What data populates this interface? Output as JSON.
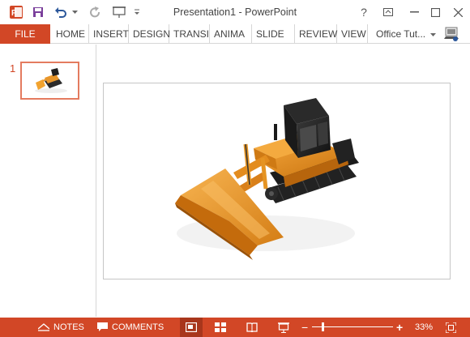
{
  "window": {
    "title": "Presentation1 - PowerPoint",
    "help_label": "?"
  },
  "quick_access": {
    "app_icon": "powerpoint-logo-icon",
    "save_icon": "save-icon",
    "undo_icon": "undo-icon",
    "redo_icon": "redo-icon",
    "present_icon": "present-from-start-icon",
    "customize_icon": "customize-qat-icon"
  },
  "ribbon": {
    "file_label": "FILE",
    "tabs": [
      {
        "label": "HOME"
      },
      {
        "label": "INSERT"
      },
      {
        "label": "DESIGN"
      },
      {
        "label": "TRANSI"
      },
      {
        "label": "ANIMA"
      },
      {
        "label": "SLIDE S"
      },
      {
        "label": "REVIEW"
      },
      {
        "label": "VIEW"
      }
    ],
    "account_name": "Office Tut...",
    "accent_color": "#d24726"
  },
  "thumbnails": {
    "slides": [
      {
        "number": "1",
        "selected": true,
        "content": "bulldozer-image"
      }
    ]
  },
  "slide": {
    "content": "orange-bulldozer-3d-image"
  },
  "statusbar": {
    "notes_label": "NOTES",
    "comments_label": "COMMENTS",
    "zoom_out": "−",
    "zoom_in": "+",
    "zoom_level": "33%",
    "zoom_fraction": 0.33,
    "active_view": "normal"
  }
}
